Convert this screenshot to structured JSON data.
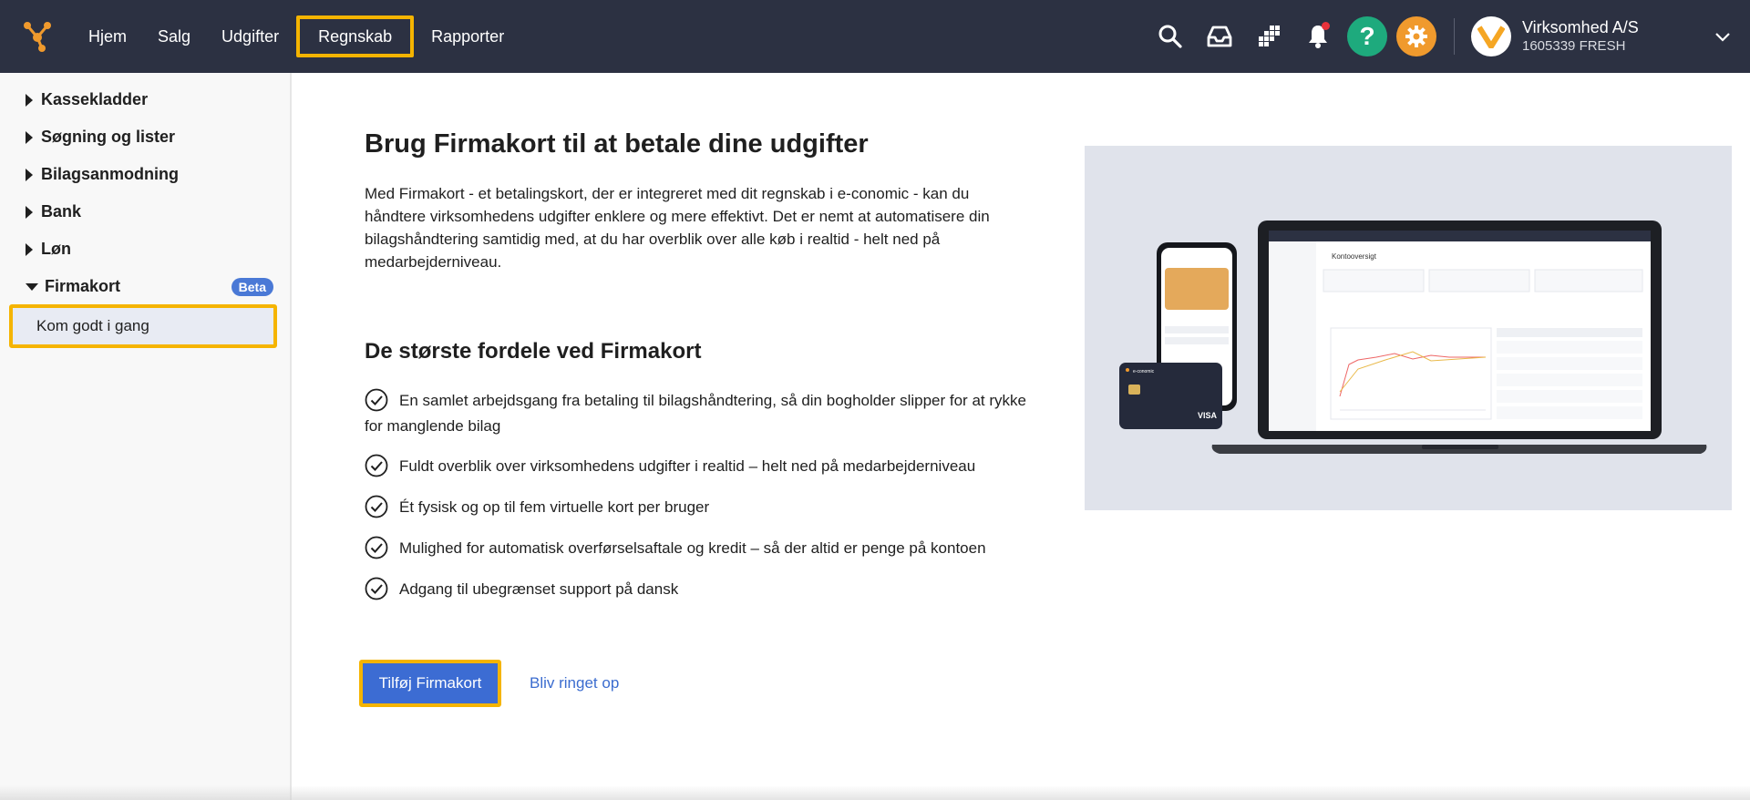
{
  "topbar": {
    "nav": [
      "Hjem",
      "Salg",
      "Udgifter",
      "Regnskab",
      "Rapporter"
    ],
    "active_nav": "Regnskab",
    "help_label": "?",
    "company": {
      "name": "Virksomhed A/S",
      "id": "1605339 FRESH"
    },
    "icons": [
      "search-icon",
      "inbox-icon",
      "apps-icon",
      "bell-icon",
      "help-icon",
      "gear-icon"
    ],
    "colors": {
      "bar": "#2c3142",
      "help": "#1eaa7d",
      "gear": "#f09a2d",
      "highlight": "#f5b400"
    }
  },
  "sidebar": {
    "items": [
      {
        "label": "Kassekladder"
      },
      {
        "label": "Søgning og lister"
      },
      {
        "label": "Bilagsanmodning"
      },
      {
        "label": "Bank"
      },
      {
        "label": "Løn"
      },
      {
        "label": "Firmakort",
        "badge": "Beta",
        "expanded": true
      }
    ],
    "sub_items": [
      {
        "label": "Kom godt i gang",
        "selected": true
      }
    ]
  },
  "main": {
    "title": "Brug Firmakort til at betale dine udgifter",
    "intro": "Med Firmakort - et betalingskort, der er integreret med dit regnskab i e-conomic - kan du håndtere virksomhedens udgifter enklere og mere effektivt. Det er nemt at automatisere din bilagshåndtering samtidig med, at du har overblik over alle køb i realtid - helt ned på medarbejderniveau.",
    "subtitle": "De største fordele ved Firmakort",
    "benefits": [
      "En samlet arbejdsgang fra betaling til bilagshåndtering, så din bogholder slipper for at rykke for manglende bilag",
      "Fuldt overblik over virksomhedens udgifter i realtid – helt ned på medarbejderniveau",
      "Ét fysisk og op til fem virtuelle kort per bruger",
      "Mulighed for automatisk overførselsaftale og kredit – så der altid er penge på kontoen",
      "Adgang til ubegrænset support på dansk"
    ],
    "cta_label": "Tilføj Firmakort",
    "link_label": "Bliv ringet op"
  },
  "illustration": {
    "laptop_heading": "Kontooversigt",
    "card_brand": "VISA",
    "card_issuer": "e-conomic"
  }
}
